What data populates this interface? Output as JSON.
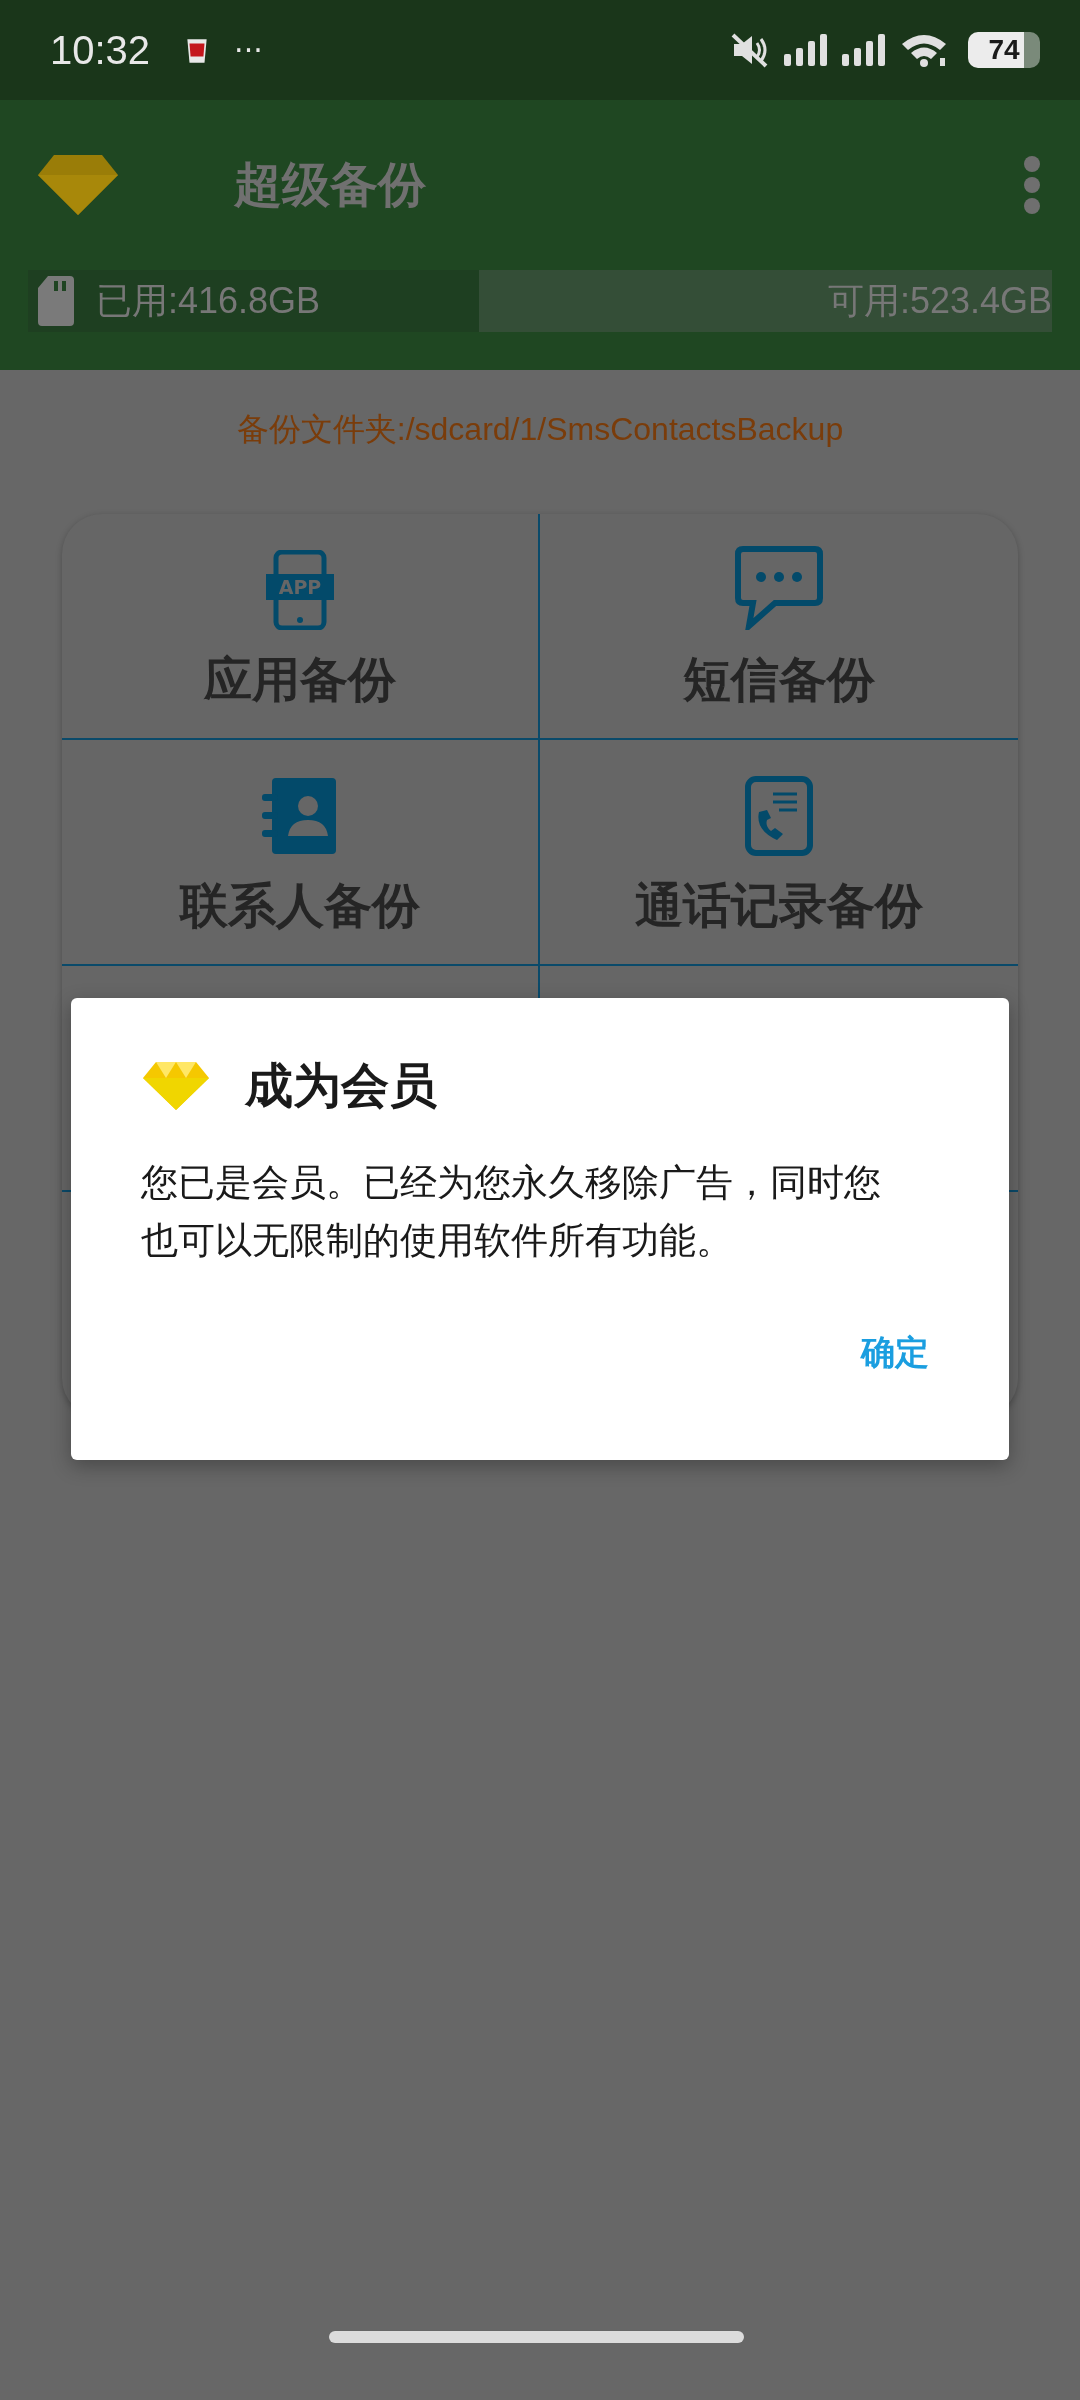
{
  "status_bar": {
    "time": "10:32",
    "more": "···",
    "battery": "74"
  },
  "app_bar": {
    "title": "超级备份"
  },
  "storage": {
    "used": "已用:416.8GB",
    "free": "可用:523.4GB",
    "level": 0.44
  },
  "folder_path": "备份文件夹:/sdcard/1/SmsContactsBackup",
  "menu": [
    {
      "kind": "app",
      "label": "应用备份",
      "icon_text": "APP"
    },
    {
      "kind": "sms",
      "label": "短信备份"
    },
    {
      "kind": "contacts",
      "label": "联系人备份"
    },
    {
      "kind": "calls",
      "label": "通话记录备份"
    }
  ],
  "dialog": {
    "title": "成为会员",
    "message": "您已是会员。已经为您永久移除广告，同时您也可以无限制的使用软件所有功能。",
    "button": "确定"
  }
}
